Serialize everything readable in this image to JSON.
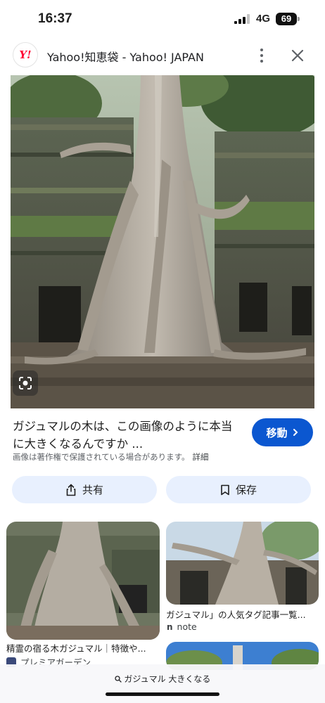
{
  "status": {
    "time": "16:37",
    "network": "4G",
    "battery": "69"
  },
  "header": {
    "logo_text": "Y!",
    "title": "Yahoo!知恵袋 - Yahoo! JAPAN"
  },
  "result": {
    "title": "ガジュマルの木は、この画像のように本当に大きくなるんですか ...",
    "visit_label": "移動",
    "copyright": "画像は著作権で保護されている場合があります。",
    "details_label": "詳細"
  },
  "actions": {
    "share_label": "共有",
    "save_label": "保存"
  },
  "related": [
    {
      "caption": "精霊の宿る木ガジュマル｜特徴や...",
      "source": "プレミアガーデン"
    },
    {
      "caption": "ガジュマル」の人気タグ記事一覧...",
      "source": "note"
    }
  ],
  "bottom_search": {
    "query": "ガジュマル 大きくなる"
  },
  "colors": {
    "accent": "#0b57d0",
    "button_bg": "#e8f0fe",
    "logo_red": "#ff0033"
  }
}
